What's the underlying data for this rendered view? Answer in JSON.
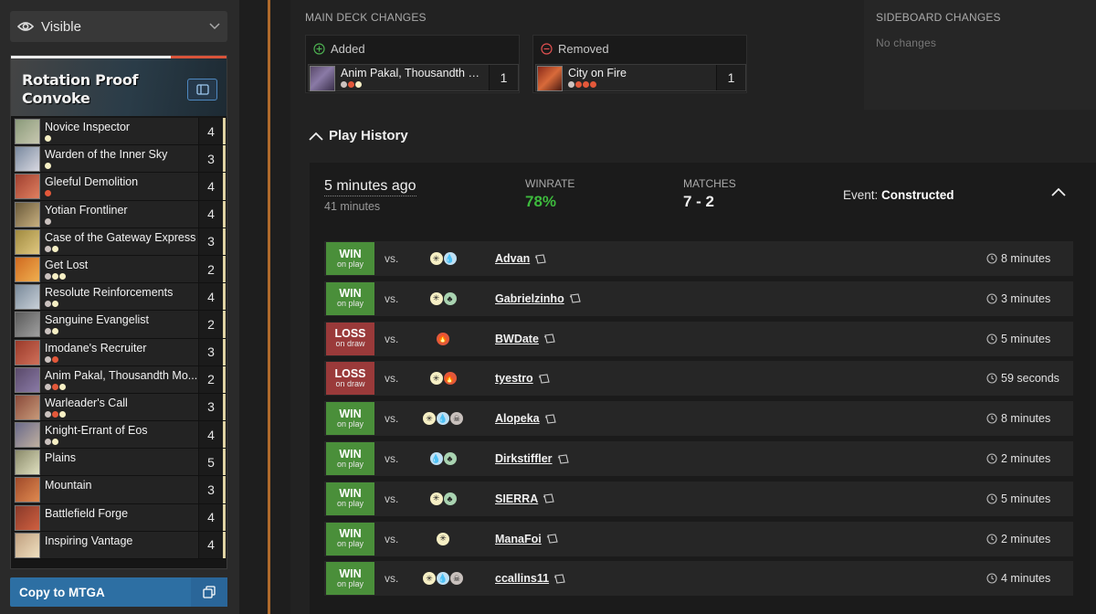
{
  "sidebar": {
    "visibility": {
      "label": "Visible"
    },
    "deck": {
      "title_line1": "Rotation Proof",
      "title_line2": "Convoke",
      "cards": [
        {
          "name": "Novice Inspector",
          "count": "4",
          "pips": [
            "W"
          ]
        },
        {
          "name": "Warden of the Inner Sky",
          "count": "3",
          "pips": [
            "W"
          ]
        },
        {
          "name": "Gleeful Demolition",
          "count": "4",
          "pips": [
            "R"
          ]
        },
        {
          "name": "Yotian Frontliner",
          "count": "4",
          "pips": [
            "C"
          ]
        },
        {
          "name": "Case of the Gateway Express",
          "count": "3",
          "pips": [
            "C",
            "W"
          ]
        },
        {
          "name": "Get Lost",
          "count": "2",
          "pips": [
            "C",
            "W",
            "W"
          ]
        },
        {
          "name": "Resolute Reinforcements",
          "count": "4",
          "pips": [
            "C",
            "W"
          ]
        },
        {
          "name": "Sanguine Evangelist",
          "count": "2",
          "pips": [
            "C",
            "W"
          ]
        },
        {
          "name": "Imodane's Recruiter",
          "count": "3",
          "pips": [
            "C",
            "R"
          ]
        },
        {
          "name": "Anim Pakal, Thousandth Mo...",
          "count": "2",
          "pips": [
            "C",
            "R",
            "W"
          ]
        },
        {
          "name": "Warleader's Call",
          "count": "3",
          "pips": [
            "C",
            "R",
            "W"
          ]
        },
        {
          "name": "Knight-Errant of Eos",
          "count": "4",
          "pips": [
            "C",
            "W"
          ]
        },
        {
          "name": "Plains",
          "count": "5",
          "pips": []
        },
        {
          "name": "Mountain",
          "count": "3",
          "pips": []
        },
        {
          "name": "Battlefield Forge",
          "count": "4",
          "pips": []
        },
        {
          "name": "Inspiring Vantage",
          "count": "4",
          "pips": []
        }
      ]
    },
    "copy_label": "Copy to MTGA"
  },
  "changes": {
    "main_header": "MAIN DECK CHANGES",
    "added": {
      "label": "Added",
      "card": "Anim Pakal, Thousandth Mo...",
      "count": "1"
    },
    "removed": {
      "label": "Removed",
      "card": "City on Fire",
      "count": "1"
    },
    "sideboard_header": "SIDEBOARD CHANGES",
    "sideboard_text": "No changes"
  },
  "history": {
    "title": "Play History",
    "summary": {
      "time": "5 minutes ago",
      "duration": "41 minutes",
      "winrate_label": "WINRATE",
      "winrate": "78%",
      "matches_label": "MATCHES",
      "matches": "7 - 2",
      "event_label": "Event:",
      "event": "Constructed"
    },
    "vs_label": "vs.",
    "matches": [
      {
        "result": "WIN",
        "play": "on play",
        "colors": [
          "W",
          "U"
        ],
        "opponent": "Advan",
        "duration": "8 minutes"
      },
      {
        "result": "WIN",
        "play": "on play",
        "colors": [
          "W",
          "G"
        ],
        "opponent": "Gabrielzinho",
        "duration": "3 minutes"
      },
      {
        "result": "LOSS",
        "play": "on draw",
        "colors": [
          "R"
        ],
        "opponent": "BWDate",
        "duration": "5 minutes"
      },
      {
        "result": "LOSS",
        "play": "on draw",
        "colors": [
          "W",
          "R"
        ],
        "opponent": "tyestro",
        "duration": "59 seconds"
      },
      {
        "result": "WIN",
        "play": "on play",
        "colors": [
          "W",
          "U",
          "B"
        ],
        "opponent": "Alopeka",
        "duration": "8 minutes"
      },
      {
        "result": "WIN",
        "play": "on play",
        "colors": [
          "U",
          "G"
        ],
        "opponent": "Dirkstiffler",
        "duration": "2 minutes"
      },
      {
        "result": "WIN",
        "play": "on play",
        "colors": [
          "W",
          "G"
        ],
        "opponent": "SIERRA",
        "duration": "5 minutes"
      },
      {
        "result": "WIN",
        "play": "on play",
        "colors": [
          "W"
        ],
        "opponent": "ManaFoi",
        "duration": "2 minutes"
      },
      {
        "result": "WIN",
        "play": "on play",
        "colors": [
          "W",
          "U",
          "B"
        ],
        "opponent": "ccallins11",
        "duration": "4 minutes"
      }
    ]
  },
  "colors": {
    "accent_blue": "#2d6fa3",
    "win_green": "#4a8f3a",
    "loss_red": "#9a3a3a",
    "winrate_green": "#3dba3d",
    "divider_orange": "#b06a2c"
  }
}
